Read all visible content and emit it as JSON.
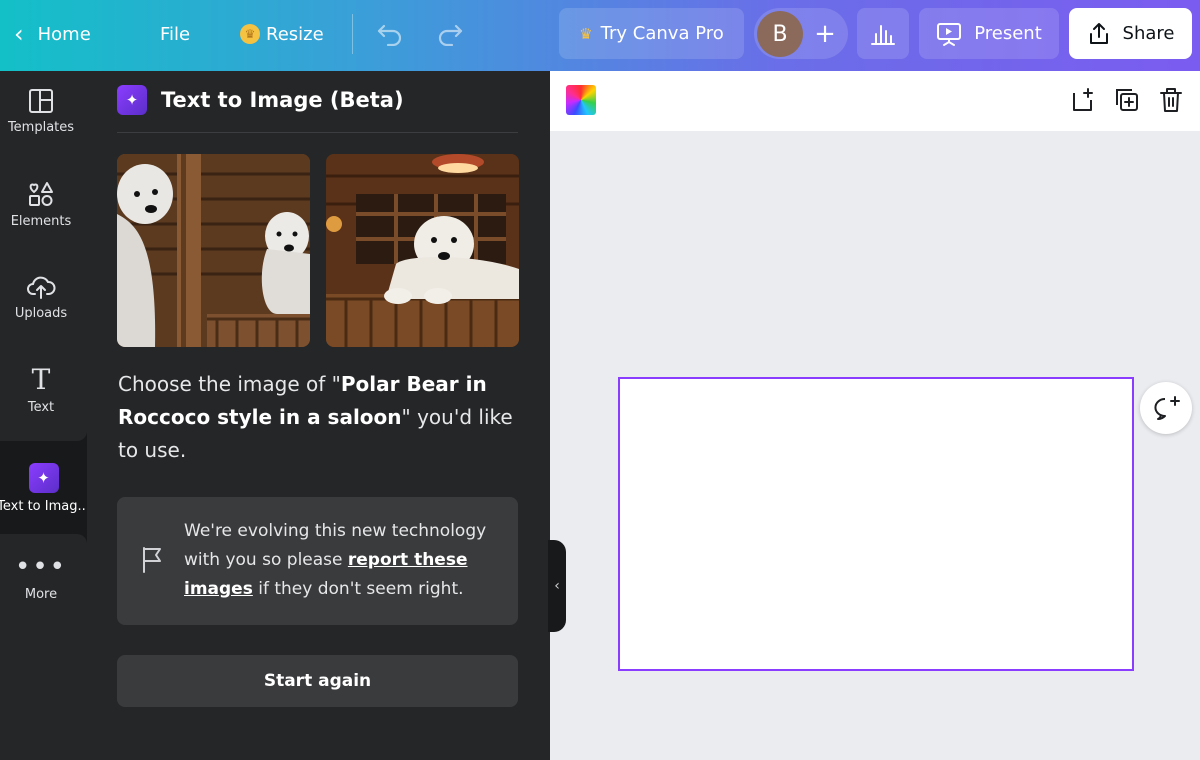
{
  "topbar": {
    "home_label": "Home",
    "file_label": "File",
    "resize_label": "Resize",
    "try_pro_label": "Try Canva Pro",
    "avatar_initial": "B",
    "present_label": "Present",
    "share_label": "Share",
    "gradient_colors": [
      "#13c0c8",
      "#7b5cf0"
    ]
  },
  "sidebar": {
    "items": [
      {
        "label": "Templates",
        "icon": "templates-icon"
      },
      {
        "label": "Elements",
        "icon": "elements-icon"
      },
      {
        "label": "Uploads",
        "icon": "uploads-icon"
      },
      {
        "label": "Text",
        "icon": "text-icon"
      },
      {
        "label": "Text to Imag...",
        "icon": "text-to-image-icon",
        "active": true
      },
      {
        "label": "More",
        "icon": "more-icon"
      }
    ]
  },
  "panel": {
    "title": "Text to Image (Beta)",
    "choose_prefix": "Choose the image of \"",
    "prompt": "Polar Bear in Roccoco style in a saloon",
    "choose_suffix": "\" you'd like to use.",
    "notice_text_1": "We're evolving this new technology with you so please ",
    "notice_link": "report these images",
    "notice_text_2": " if they don't seem right.",
    "start_again_label": "Start again"
  },
  "canvas": {
    "accent_color": "#8b3dff"
  }
}
